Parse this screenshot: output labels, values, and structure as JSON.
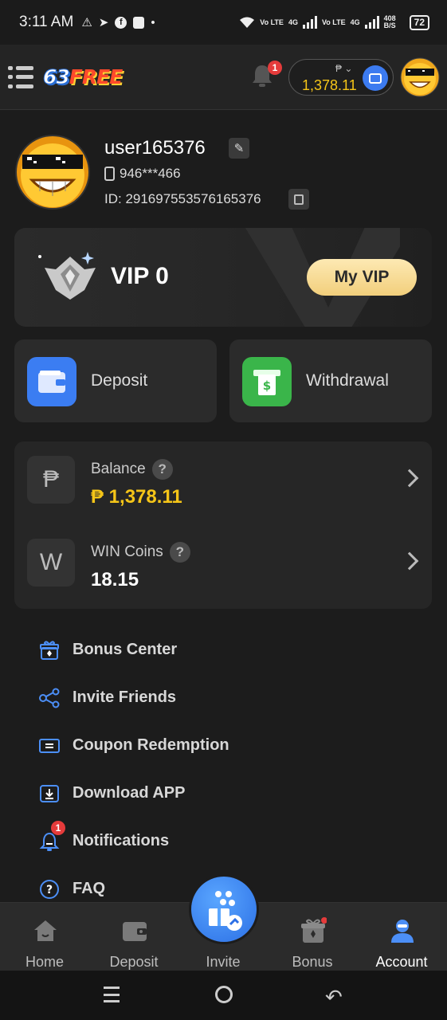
{
  "status_bar": {
    "time": "3:11 AM",
    "left_icons": [
      "warning-icon",
      "telegram-icon",
      "facebook-icon",
      "messenger-icon",
      "dot-icon"
    ],
    "net1": "Vo LTE",
    "net2": "4G",
    "speed": "408 B/S",
    "battery": "72"
  },
  "header": {
    "logo_part1": "63",
    "logo_part2": "FREE",
    "notification_count": "1",
    "currency": "₱",
    "wallet_amount": "1,378.11"
  },
  "profile": {
    "username": "user165376",
    "phone": "946***466",
    "id_text": "ID: 291697553576165376"
  },
  "vip": {
    "level": "VIP 0",
    "button": "My VIP"
  },
  "actions": {
    "deposit": "Deposit",
    "withdrawal": "Withdrawal"
  },
  "balance": {
    "label": "Balance",
    "value": "₱ 1,378.11",
    "icon_char": "₱"
  },
  "coins": {
    "label": "WIN Coins",
    "value": "18.15",
    "icon_char": "W"
  },
  "menu": [
    {
      "label": "Bonus Center",
      "icon": "gift-icon"
    },
    {
      "label": "Invite Friends",
      "icon": "share-icon"
    },
    {
      "label": "Coupon Redemption",
      "icon": "ticket-icon"
    },
    {
      "label": "Download APP",
      "icon": "download-icon"
    },
    {
      "label": "Notifications",
      "icon": "bell-icon",
      "badge": "1"
    },
    {
      "label": "FAQ",
      "icon": "help-icon"
    }
  ],
  "bottom_nav": {
    "home": "Home",
    "deposit": "Deposit",
    "invite": "Invite",
    "bonus": "Bonus",
    "account": "Account"
  },
  "colors": {
    "accent_gold": "#f5c518",
    "deposit_blue": "#3b7df2",
    "withdraw_green": "#3ab54a",
    "badge_red": "#e53b3b"
  }
}
